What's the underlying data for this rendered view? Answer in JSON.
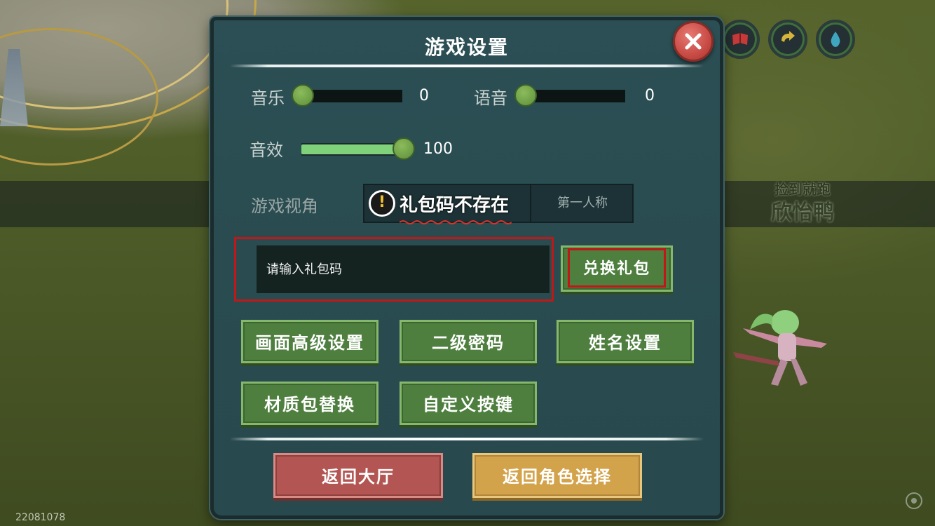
{
  "world": {
    "player_nick_small": "捡到就跑",
    "player_nick_big": "欣怡鸭",
    "build_id": "22081078"
  },
  "hud": {
    "icons": [
      "book-icon",
      "refresh-arrow-icon",
      "water-drop-icon"
    ],
    "colors": {
      "book": "#c83a3a",
      "arrow": "#d6b63a",
      "drop": "#3fa6c0"
    }
  },
  "settings": {
    "title": "游戏设置",
    "music": {
      "label": "音乐",
      "value": "0",
      "level": 0
    },
    "voice": {
      "label": "语音",
      "value": "0",
      "level": 0
    },
    "sfx": {
      "label": "音效",
      "value": "100",
      "level": 100
    },
    "view": {
      "label": "游戏视角",
      "right_option": "第一人称"
    },
    "toast": "礼包码不存在",
    "gift": {
      "placeholder": "请输入礼包码",
      "redeem": "兑换礼包"
    },
    "buttons": [
      "画面高级设置",
      "二级密码",
      "姓名设置",
      "材质包替换",
      "自定义按键"
    ],
    "lobby": "返回大厅",
    "role_select": "返回角色选择"
  },
  "colors": {
    "panel": "#2b4f54",
    "green_btn": "#4e7f3f",
    "red_btn": "#b35653",
    "gold_btn": "#d3a34b",
    "slider_fill": "#7fd27a",
    "highlight": "#c01818"
  }
}
